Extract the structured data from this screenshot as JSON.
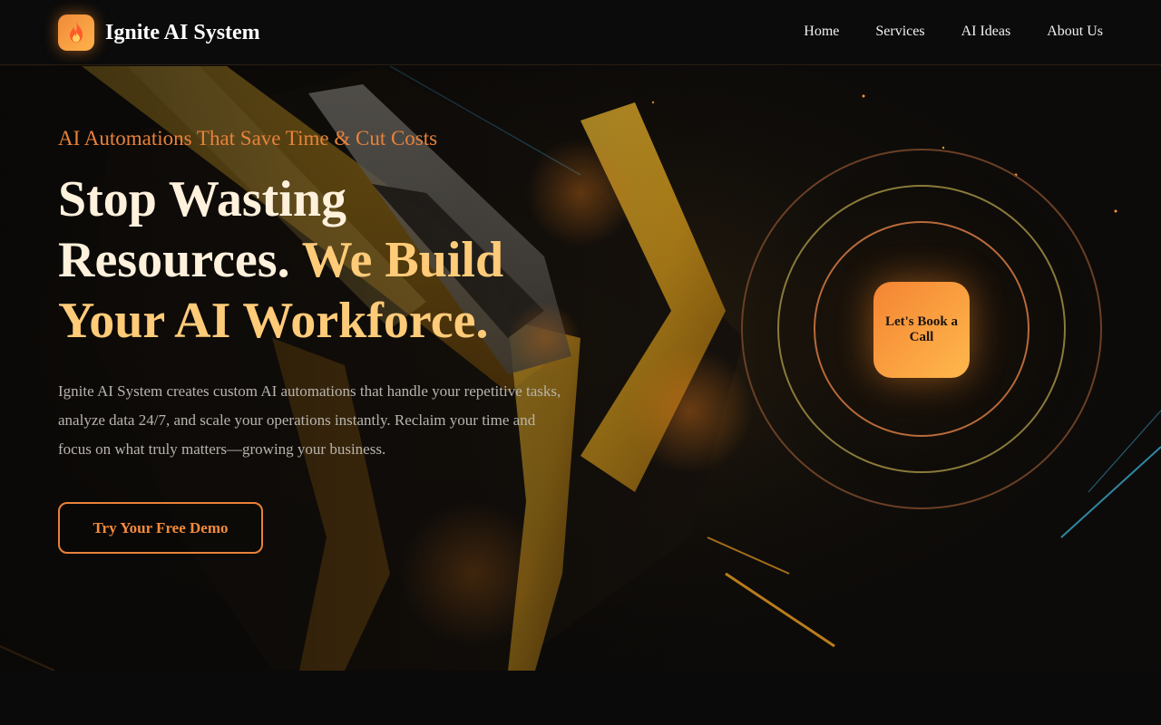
{
  "nav": {
    "brand": "Ignite AI System",
    "logo_icon": "flame-icon",
    "links": [
      "Home",
      "Services",
      "AI Ideas",
      "About Us"
    ]
  },
  "hero": {
    "tagline": "AI Automations That Save Time & Cut Costs",
    "headline_line1": "Stop Wasting",
    "headline_line2a": "Resources.",
    "headline_line2b": "We Build",
    "headline_line3": "Your AI Workforce.",
    "description": "Ignite AI System creates custom AI automations that handle your repetitive tasks, analyze data 24/7, and scale your operations instantly. Reclaim your time and focus on what truly matters—growing your business.",
    "cta_label": "Try Your Free Demo",
    "book_call_label": "Let's Book a Call"
  },
  "colors": {
    "accent_orange": "#e8823a",
    "headline_cream": "#fff1dc",
    "headline_gold": "#ffcb79",
    "background": "#0a0a0a"
  }
}
